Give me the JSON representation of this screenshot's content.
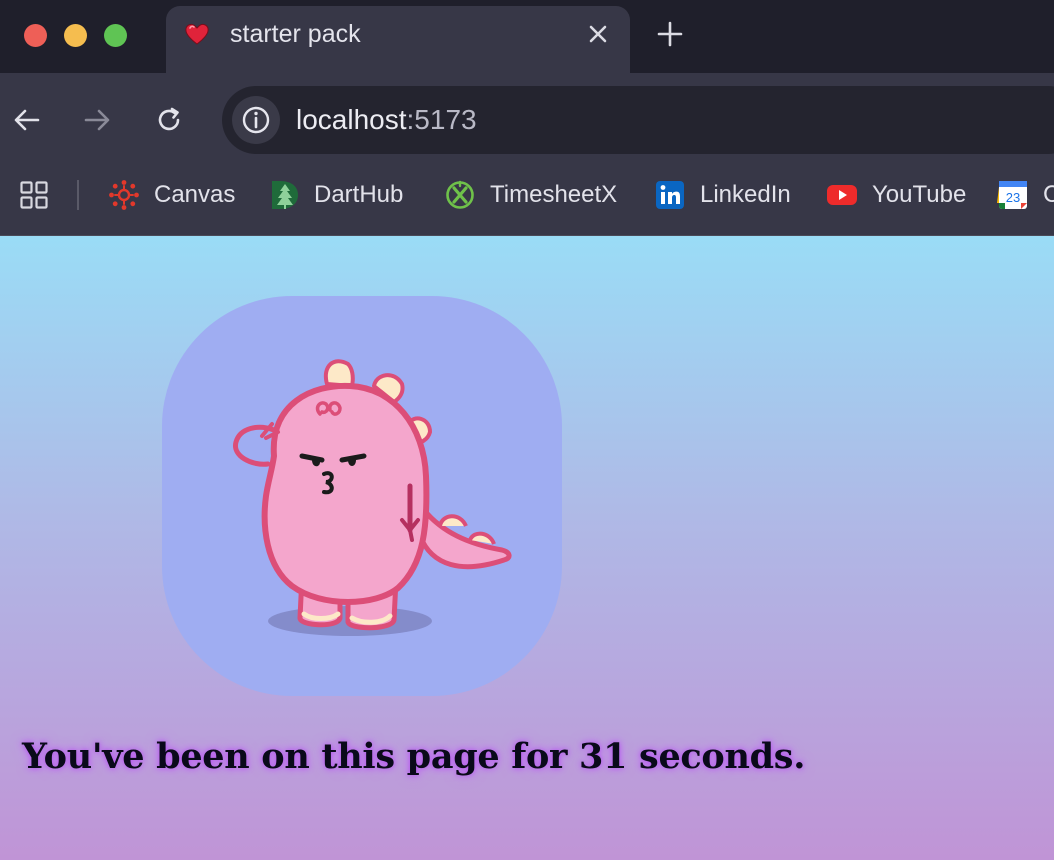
{
  "window": {
    "tab": {
      "title": "starter pack",
      "favicon": "heart-icon"
    }
  },
  "toolbar": {
    "url_host": "localhost",
    "url_port": ":5173"
  },
  "bookmarks": [
    {
      "label": "Canvas",
      "icon": "canvas-icon"
    },
    {
      "label": "DartHub",
      "icon": "darthub-icon"
    },
    {
      "label": "TimesheetX",
      "icon": "timesheetx-icon"
    },
    {
      "label": "LinkedIn",
      "icon": "linkedin-icon"
    },
    {
      "label": "YouTube",
      "icon": "youtube-icon"
    },
    {
      "label": "C",
      "icon": "calendar-icon",
      "icon_text": "23"
    }
  ],
  "page": {
    "timer_text": "You've been on this page for 31 seconds.",
    "avatar": "pink-dinosaur-illustration"
  },
  "colors": {
    "accent_glow": "#b24cf0",
    "card": "#9fadf2",
    "dino_body": "#f4a6cc",
    "dino_outline": "#dc4e78"
  }
}
